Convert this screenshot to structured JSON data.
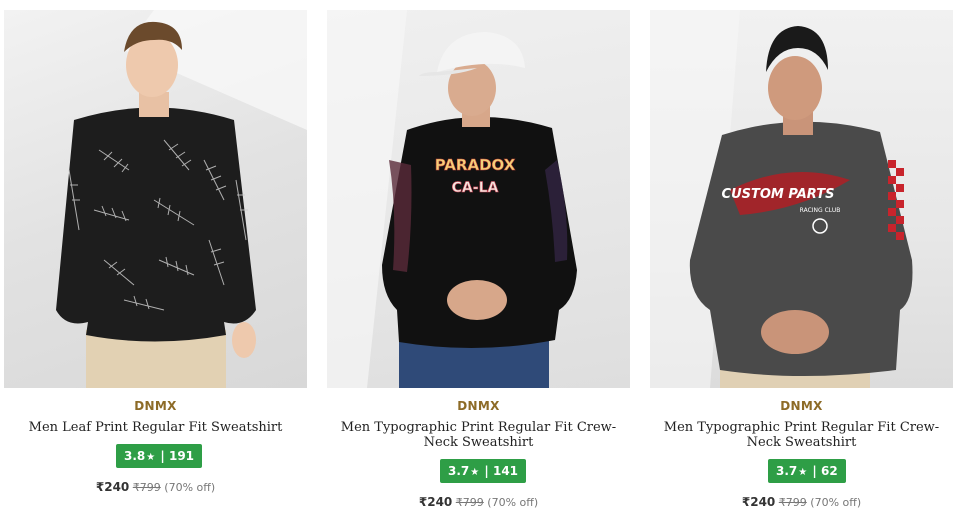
{
  "products": [
    {
      "brand": "DNMX",
      "name": "Men Leaf Print Regular Fit Sweatshirt",
      "rating": "3.8",
      "star": "★",
      "reviews": "| 191",
      "price": "₹240",
      "mrp": "₹799",
      "discount": "(70% off)",
      "image": "black leaf-print sweatshirt model"
    },
    {
      "brand": "DNMX",
      "name": "Men Typographic Print Regular Fit Crew-Neck Sweatshirt",
      "rating": "3.7",
      "star": "★",
      "reviews": "| 141",
      "price": "₹240",
      "mrp": "₹799",
      "discount": "(70% off)",
      "image": "black typographic sweatshirt model with white cap",
      "print_text": [
        "PARADOX",
        "CA-LA"
      ]
    },
    {
      "brand": "DNMX",
      "name": "Men Typographic Print Regular Fit Crew-Neck Sweatshirt",
      "rating": "3.7",
      "star": "★",
      "reviews": "| 62",
      "price": "₹240",
      "mrp": "₹799",
      "discount": "(70% off)",
      "image": "grey racing-print sweatshirt model",
      "print_text": [
        "CUSTOM PARTS",
        "RACING CLUB"
      ]
    }
  ],
  "colors": {
    "brand": "#8d6b27",
    "rating_bg": "#2e9e46",
    "name": "#222222",
    "price_muted": "#777777"
  }
}
